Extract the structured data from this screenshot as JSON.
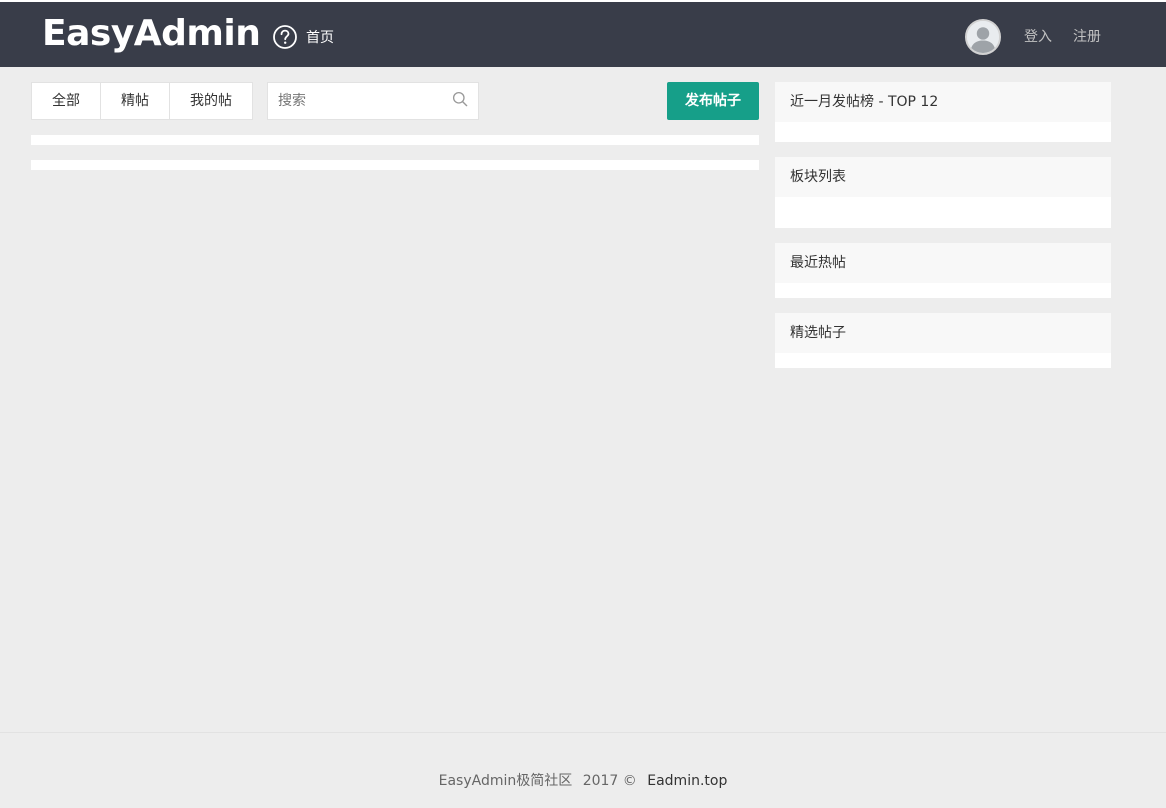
{
  "header": {
    "logo": "EasyAdmin",
    "nav_home": "首页",
    "login": "登入",
    "register": "注册"
  },
  "filters": {
    "tabs": [
      "全部",
      "精帖",
      "我的帖"
    ],
    "search_placeholder": "搜索",
    "publish_label": "发布帖子"
  },
  "sidebar": {
    "panels": [
      "近一月发帖榜 - TOP 12",
      "板块列表",
      "最近热帖",
      "精选帖子"
    ]
  },
  "footer": {
    "site": "EasyAdmin极简社区",
    "copyright": "2017 ©",
    "link": "Eadmin.top"
  },
  "colors": {
    "header_bg": "#393d49",
    "accent": "#169f89",
    "page_bg": "#ededed"
  },
  "icons": {
    "home": "help-circle-icon",
    "search": "search-icon",
    "avatar": "user-avatar-icon"
  }
}
